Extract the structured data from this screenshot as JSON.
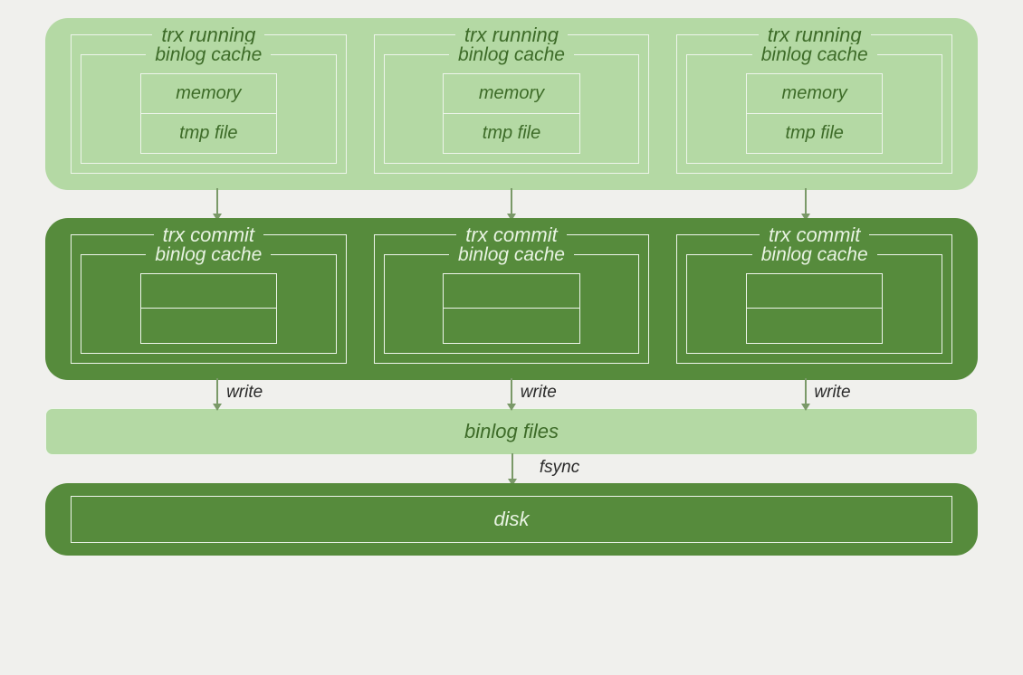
{
  "row1": {
    "blocks": [
      {
        "title": "trx running",
        "cache_label": "binlog cache",
        "cells": [
          "memory",
          "tmp file"
        ]
      },
      {
        "title": "trx running",
        "cache_label": "binlog cache",
        "cells": [
          "memory",
          "tmp file"
        ]
      },
      {
        "title": "trx running",
        "cache_label": "binlog cache",
        "cells": [
          "memory",
          "tmp file"
        ]
      }
    ]
  },
  "row2": {
    "blocks": [
      {
        "title": "trx commit",
        "cache_label": "binlog cache"
      },
      {
        "title": "trx commit",
        "cache_label": "binlog cache"
      },
      {
        "title": "trx commit",
        "cache_label": "binlog cache"
      }
    ]
  },
  "arrows_write": [
    "write",
    "write",
    "write"
  ],
  "binlog_files_label": "binlog files",
  "fsync_label": "fsync",
  "disk_label": "disk"
}
